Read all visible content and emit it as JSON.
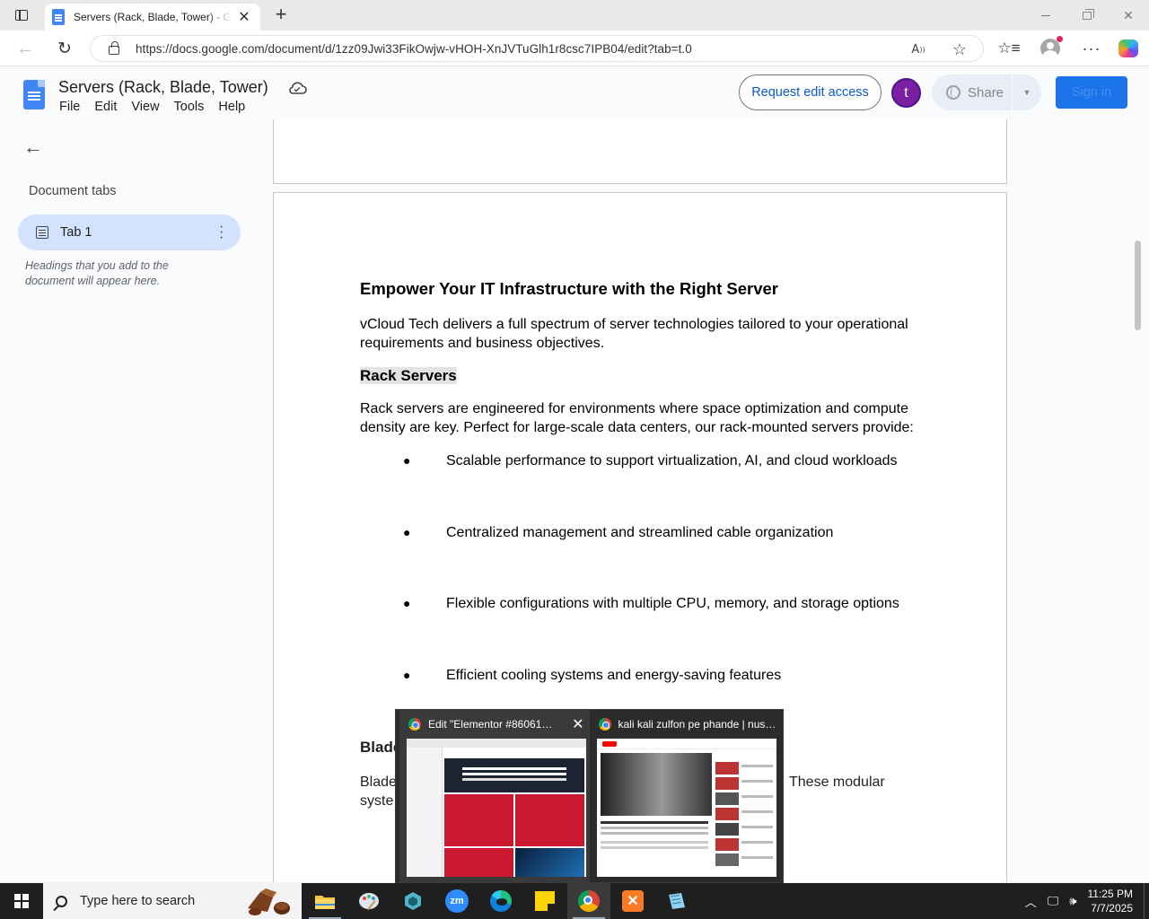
{
  "browser": {
    "tab_title": "Servers (Rack, Blade, Tower) - Goo",
    "url": "https://docs.google.com/document/d/1zz09Jwi33FikOwjw-vHOH-XnJVTuGlh1r8csc7IPB04/edit?tab=t.0",
    "icons": [
      "tab-actions-icon",
      "close-icon",
      "plus-icon",
      "back-icon",
      "reload-icon",
      "lock-icon",
      "read-aloud-icon",
      "star-icon",
      "favorites-icon",
      "profile-icon",
      "more-icon",
      "copilot-icon"
    ]
  },
  "docs": {
    "title": "Servers (Rack, Blade, Tower)",
    "menu": [
      "File",
      "Edit",
      "View",
      "Tools",
      "Help"
    ],
    "request_edit_label": "Request edit access",
    "avatar_letter": "t",
    "share_label": "Share",
    "signin_label": "Sign in",
    "colors": {
      "accent": "#0b57d0",
      "avatar": "#7b1fa2",
      "signin": "#1a73e8",
      "tab_pill": "#d3e3fd"
    }
  },
  "outline": {
    "heading": "Document tabs",
    "tab_label": "Tab 1",
    "hint": "Headings that you add to the document will appear here."
  },
  "document": {
    "heading": "Empower Your IT Infrastructure with the Right Server",
    "intro": "vCloud Tech delivers a full spectrum of server technologies tailored to your operational requirements and business objectives.",
    "rack_heading": "Rack Servers",
    "rack_intro": "Rack servers are engineered for environments where space optimization and compute density are key. Perfect for large-scale data centers, our rack-mounted servers provide:",
    "bullets": [
      "Scalable performance to support virtualization, AI, and cloud workloads",
      "Centralized management and streamlined cable organization",
      "Flexible configurations with multiple CPU, memory, and storage options",
      "Efficient cooling systems and energy-saving features"
    ],
    "blade_heading_visible": "Blade",
    "blade_line1_left": "Blade",
    "blade_line1_right": "These modular",
    "blade_line2_left": "syste"
  },
  "previews": [
    {
      "title": "Edit \"Elementor #86061\" ..."
    },
    {
      "title": "kali kali zulfon pe phande | nusr..."
    }
  ],
  "taskbar": {
    "search_placeholder": "Type here to search",
    "time": "11:25 PM",
    "date": "7/7/2025",
    "apps": [
      "file-explorer-icon",
      "paint-icon",
      "app-icon",
      "zoom-icon",
      "edge-icon",
      "sticky-notes-icon",
      "chrome-icon",
      "xampp-icon",
      "notepad-icon"
    ]
  }
}
